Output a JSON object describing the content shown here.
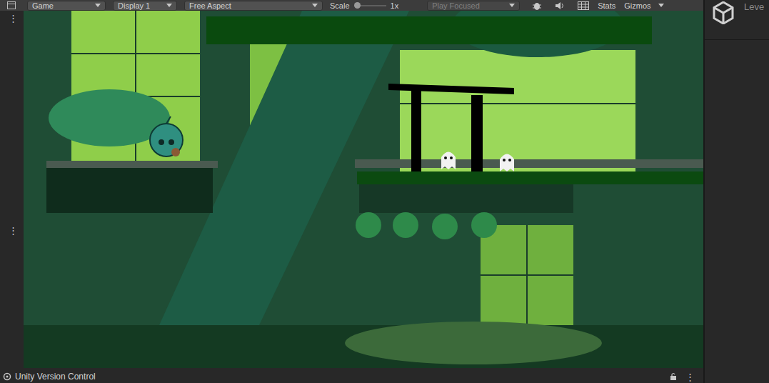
{
  "toolbar": {
    "menu_icon": "⋮",
    "dropdowns": [
      {
        "label": "Game",
        "disabled": false
      },
      {
        "label": "Display 1",
        "disabled": false
      },
      {
        "label": "Free Aspect",
        "disabled": false
      }
    ],
    "scale": {
      "label": "Scale",
      "level": 0.0,
      "reading": "1x"
    },
    "play_mode": {
      "label": "Play Focused",
      "disabled": true
    },
    "toggles": [
      {
        "label": "Stats",
        "selected": false
      },
      {
        "label": "Gizmos",
        "selected": false
      }
    ]
  },
  "side_strip": {
    "menu_icons": [
      "⋮",
      "⋮"
    ]
  },
  "inspector": {
    "tab_label": "Leve"
  },
  "bottom_bar": {
    "title": "Unity Version Control",
    "menu_icon": "⋮"
  }
}
